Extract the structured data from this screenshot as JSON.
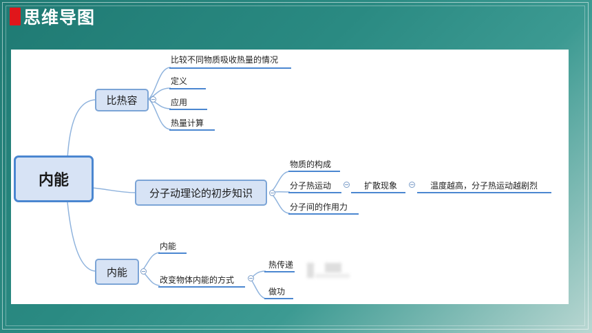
{
  "header": {
    "title": "思维导图"
  },
  "mindmap": {
    "root": "内能",
    "branches": [
      {
        "label": "比热容",
        "children": [
          "比较不同物质吸收热量的情况",
          "定义",
          "应用",
          "热量计算"
        ]
      },
      {
        "label": "分子动理论的初步知识",
        "children": [
          "物质的构成",
          "分子热运动",
          "扩散现象",
          "温度越高，分子热运动越剧烈",
          "分子间的作用力"
        ]
      },
      {
        "label": "内能",
        "children": [
          "内能",
          "改变物体内能的方式",
          "热传递",
          "做功"
        ]
      }
    ]
  }
}
